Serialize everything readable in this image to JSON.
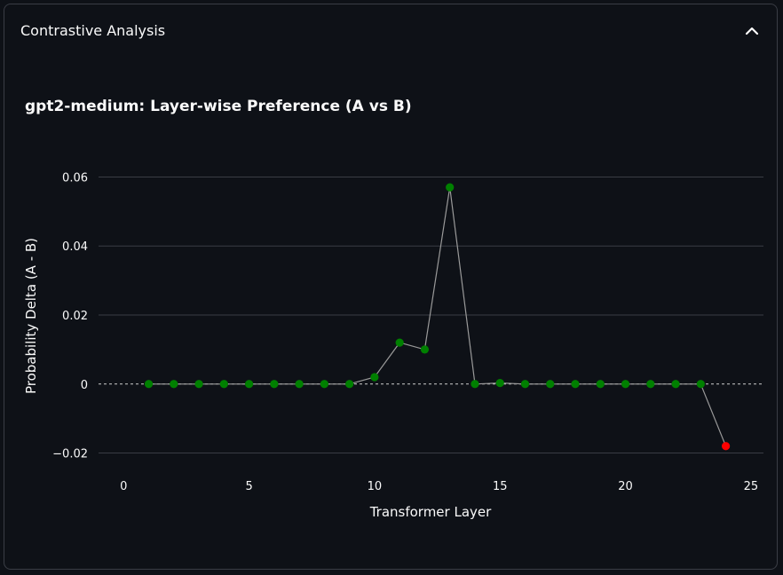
{
  "panel": {
    "title": "Contrastive Analysis",
    "collapse_icon": "chevron-up-icon"
  },
  "colors": {
    "background": "#0e1117",
    "text": "#fafafa",
    "grid": "#3a3d45",
    "line": "#9a9a9a",
    "positive": "#008000",
    "negative": "#ff0000"
  },
  "chart_data": {
    "type": "scatter",
    "title": "gpt2-medium: Layer-wise Preference (A vs B)",
    "xlabel": "Transformer Layer",
    "ylabel": "Probability Delta (A - B)",
    "xlim": [
      -1,
      25.5
    ],
    "ylim": [
      -0.025,
      0.065
    ],
    "xticks": [
      0,
      5,
      10,
      15,
      20,
      25
    ],
    "yticks": [
      -0.02,
      0,
      0.02,
      0.04,
      0.06
    ],
    "ytick_labels": [
      "−0.02",
      "0",
      "0.02",
      "0.04",
      "0.06"
    ],
    "grid": "horizontal",
    "zero_reference_line": "dashed",
    "series": [
      {
        "x": [
          1,
          2,
          3,
          4,
          5,
          6,
          7,
          8,
          9,
          10,
          11,
          12,
          13,
          14,
          15,
          16,
          17,
          18,
          19,
          20,
          21,
          22,
          23,
          24
        ],
        "y": [
          0,
          0,
          0,
          0,
          0,
          0,
          0,
          0,
          0,
          0.002,
          0.012,
          0.01,
          0.057,
          0,
          0.0003,
          0,
          0,
          0,
          0,
          0,
          0,
          0,
          0,
          -0.018
        ]
      }
    ]
  }
}
